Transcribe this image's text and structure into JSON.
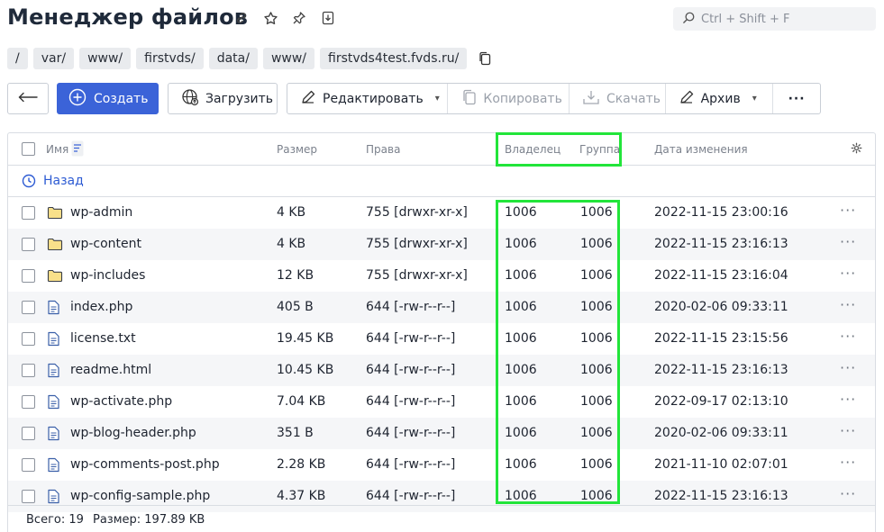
{
  "header": {
    "title": "Менеджер файлов",
    "search_placeholder": "Ctrl + Shift + F"
  },
  "breadcrumbs": [
    "/",
    "var/",
    "www/",
    "firstvds/",
    "data/",
    "www/",
    "firstvds4test.fvds.ru/"
  ],
  "toolbar": {
    "create": "Создать",
    "upload": "Загрузить",
    "edit": "Редактировать",
    "copy": "Копировать",
    "download": "Скачать",
    "archive": "Архив",
    "more": "···"
  },
  "table": {
    "columns": {
      "name": "Имя",
      "size": "Размер",
      "perms": "Права",
      "owner": "Владелец",
      "group": "Группа",
      "modified": "Дата изменения"
    },
    "back_label": "Назад",
    "rows": [
      {
        "type": "folder",
        "name": "wp-admin",
        "size": "4 KB",
        "perms": "755 [drwxr-xr-x]",
        "owner": "1006",
        "group": "1006",
        "modified": "2022-11-15 23:00:16"
      },
      {
        "type": "folder",
        "name": "wp-content",
        "size": "4 KB",
        "perms": "755 [drwxr-xr-x]",
        "owner": "1006",
        "group": "1006",
        "modified": "2022-11-15 23:16:13"
      },
      {
        "type": "folder",
        "name": "wp-includes",
        "size": "12 KB",
        "perms": "755 [drwxr-xr-x]",
        "owner": "1006",
        "group": "1006",
        "modified": "2022-11-15 23:16:04"
      },
      {
        "type": "file",
        "name": "index.php",
        "size": "405 B",
        "perms": "644 [-rw-r--r--]",
        "owner": "1006",
        "group": "1006",
        "modified": "2020-02-06 09:33:11"
      },
      {
        "type": "file",
        "name": "license.txt",
        "size": "19.45 KB",
        "perms": "644 [-rw-r--r--]",
        "owner": "1006",
        "group": "1006",
        "modified": "2022-11-15 23:15:56"
      },
      {
        "type": "file",
        "name": "readme.html",
        "size": "10.45 KB",
        "perms": "644 [-rw-r--r--]",
        "owner": "1006",
        "group": "1006",
        "modified": "2022-11-15 23:16:13"
      },
      {
        "type": "file",
        "name": "wp-activate.php",
        "size": "7.04 KB",
        "perms": "644 [-rw-r--r--]",
        "owner": "1006",
        "group": "1006",
        "modified": "2022-09-17 02:13:10"
      },
      {
        "type": "file",
        "name": "wp-blog-header.php",
        "size": "351 B",
        "perms": "644 [-rw-r--r--]",
        "owner": "1006",
        "group": "1006",
        "modified": "2020-02-06 09:33:11"
      },
      {
        "type": "file",
        "name": "wp-comments-post.php",
        "size": "2.28 KB",
        "perms": "644 [-rw-r--r--]",
        "owner": "1006",
        "group": "1006",
        "modified": "2021-11-10 02:07:01"
      },
      {
        "type": "file",
        "name": "wp-config-sample.php",
        "size": "4.37 KB",
        "perms": "644 [-rw-r--r--]",
        "owner": "1006",
        "group": "1006",
        "modified": "2022-11-15 23:16:13"
      }
    ]
  },
  "footer": {
    "total": "Всего: 19",
    "size": "Размер: 197.89 KB"
  },
  "colors": {
    "accent": "#3b63d8",
    "link": "#2d5bd3",
    "highlight": "#22e53a",
    "folder": "#f5d76e"
  }
}
